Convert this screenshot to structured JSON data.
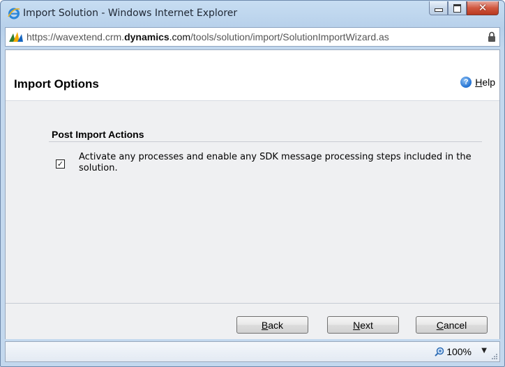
{
  "window": {
    "title": "Import Solution - Windows Internet Explorer",
    "close_glyph": "✕"
  },
  "address_bar": {
    "url_scheme": "https://",
    "url_sub": "wavextend.crm.",
    "url_domain": "dynamics",
    "url_tld": ".com",
    "url_path": "/tools/solution/import/SolutionImportWizard.as"
  },
  "page": {
    "title": "Import Options",
    "help_label": "Help",
    "help_glyph": "?"
  },
  "section": {
    "title": "Post Import Actions",
    "option_text": "Activate any processes and enable any SDK message processing steps included in the solution.",
    "option_checked": true,
    "check_glyph": "✓"
  },
  "buttons": {
    "back": "Back",
    "next": "Next",
    "cancel": "Cancel"
  },
  "status_bar": {
    "zoom": "100%",
    "dropdown_glyph": "▼"
  },
  "colors": {
    "frame": "#c3d8ee",
    "close_button": "#c8452b",
    "content_bg": "#eff0f2",
    "help_icon": "#1f6fd1"
  }
}
